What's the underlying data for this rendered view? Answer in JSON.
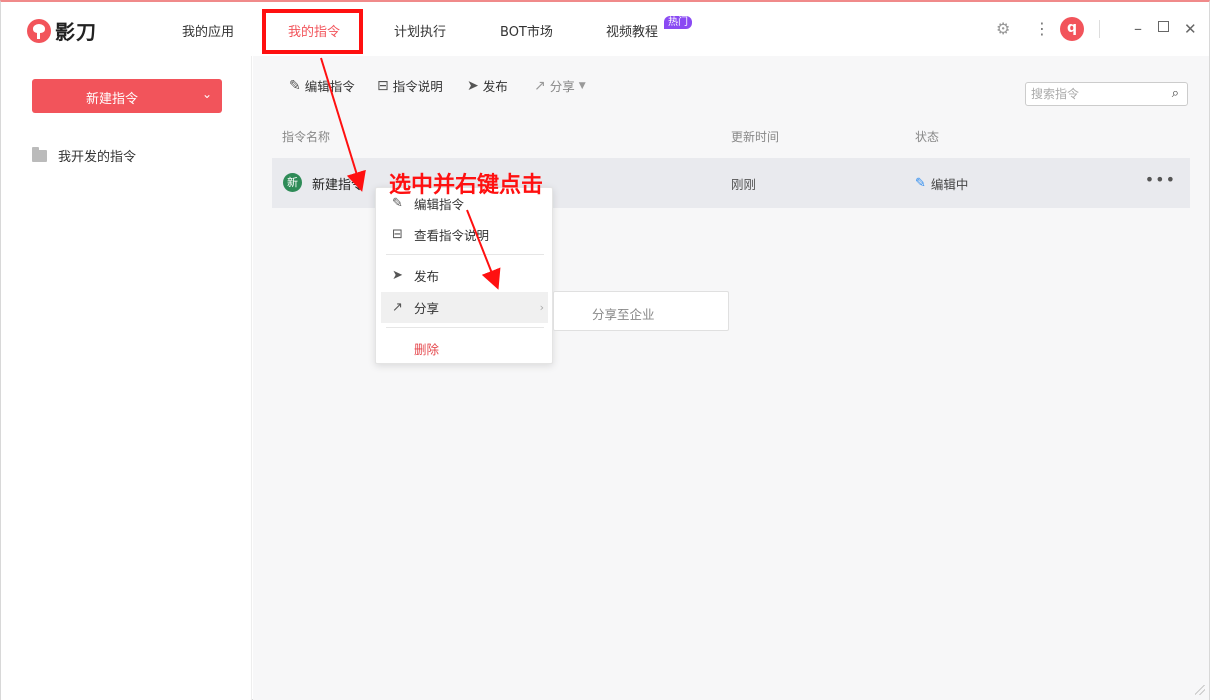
{
  "app": {
    "name": "影刀"
  },
  "nav": {
    "items": [
      "我的应用",
      "我的指令",
      "计划执行",
      "BOT市场",
      "视频教程"
    ],
    "active_index": 1,
    "hot_badge": "热门"
  },
  "titlebar_icons": [
    "settings-icon",
    "more-vertical-icon",
    "minimize-icon",
    "maximize-icon",
    "close-icon"
  ],
  "user": {
    "avatar_letter": "q"
  },
  "sidebar": {
    "new_button": "新建指令",
    "items": [
      {
        "label": "我开发的指令",
        "icon": "folder-icon"
      }
    ]
  },
  "toolbar": {
    "edit": "编辑指令",
    "doc": "指令说明",
    "publish": "发布",
    "share": "分享"
  },
  "search": {
    "placeholder": "搜索指令"
  },
  "table": {
    "headers": {
      "name": "指令名称",
      "updated": "更新时间",
      "status": "状态"
    },
    "rows": [
      {
        "badge": "新",
        "name": "新建指令",
        "updated": "刚刚",
        "status": "编辑中"
      }
    ]
  },
  "context_menu": {
    "edit": "编辑指令",
    "view_doc": "查看指令说明",
    "publish": "发布",
    "share": "分享",
    "delete": "删除"
  },
  "submenu": {
    "share_to_enterprise": "分享至企业"
  },
  "annotation": {
    "text": "选中并右键点击",
    "color": "#ff1010"
  },
  "colors": {
    "accent": "#f2545b",
    "hot_badge": "#8a4af3",
    "status_pen": "#2d8cf0",
    "new_badge": "#2e8b57"
  }
}
